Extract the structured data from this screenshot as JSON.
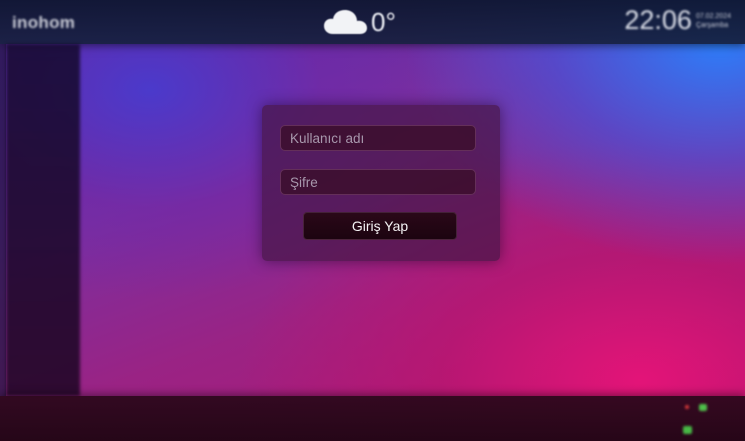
{
  "header": {
    "brand": "inohom",
    "weather": {
      "icon": "cloud-icon",
      "temperature": "0°"
    },
    "clock": {
      "time": "22:06",
      "date": "07.02.2024",
      "day": "Çarşamba"
    }
  },
  "login": {
    "username_placeholder": "Kullanıcı adı",
    "username_value": "",
    "password_placeholder": "Şifre",
    "password_value": "",
    "submit_label": "Giriş Yap"
  },
  "footer": {
    "status_icons": [
      "alert-icon",
      "connection-icon",
      "phone-icon"
    ]
  },
  "colors": {
    "background_accent": "#b51470",
    "header_bg": "#16203e",
    "dialog_bg": "#461646",
    "button_bg": "#2a0818",
    "status_green": "#4fbf4a",
    "status_red": "#d63a3a"
  }
}
